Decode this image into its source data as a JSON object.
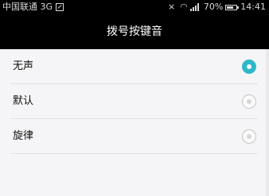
{
  "status_bar": {
    "carrier": "中国联通 3G",
    "battery": "70%",
    "time": "14:41",
    "battery_level": 0.7,
    "icons": [
      "sim-icon",
      "mute-icon",
      "wifi-icon",
      "signal-icon",
      "battery-icon"
    ]
  },
  "title": "拨号按键音",
  "options": [
    {
      "label": "无声",
      "selected": true
    },
    {
      "label": "默认",
      "selected": false
    },
    {
      "label": "旋律",
      "selected": false
    }
  ],
  "colors": {
    "accent": "#2fb8c9",
    "header_bg": "#000000",
    "page_bg": "#f5f5f7"
  }
}
